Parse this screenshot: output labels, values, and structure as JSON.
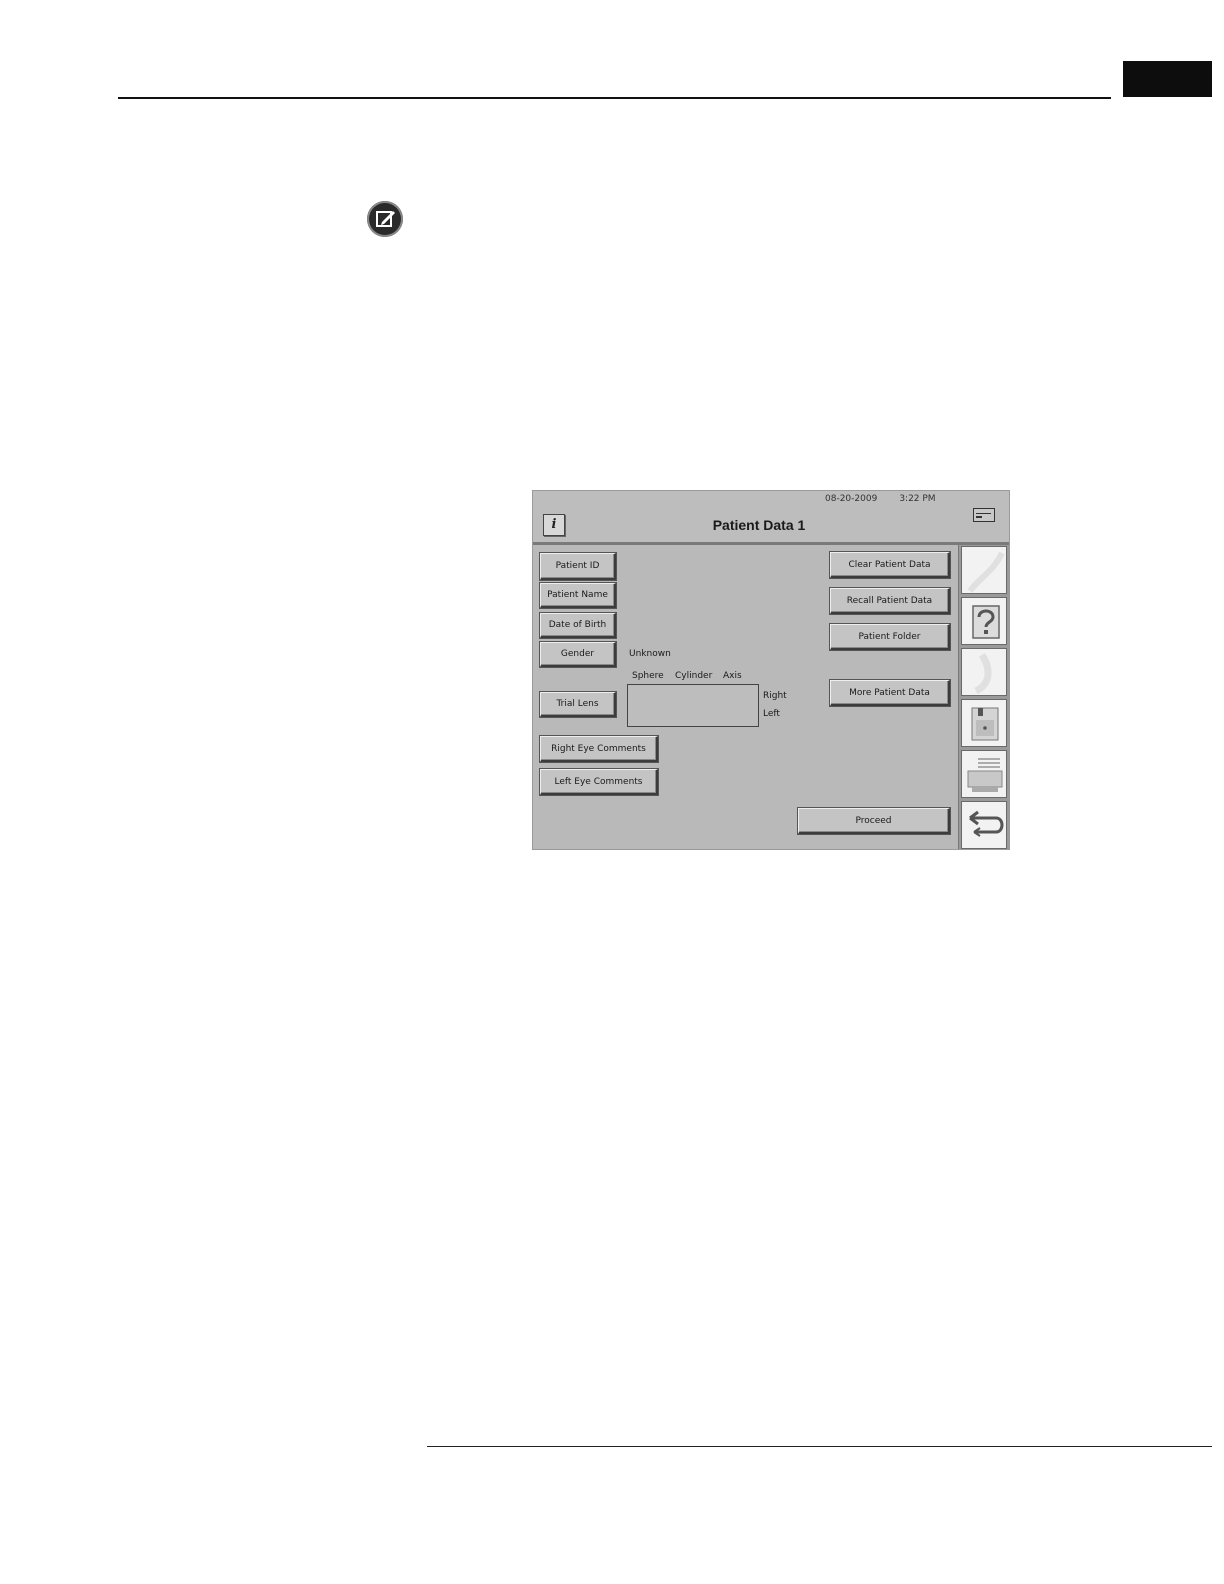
{
  "screen": {
    "date": "08-20-2009",
    "time": "3:22 PM",
    "title": "Patient Data 1",
    "info_label": "i"
  },
  "left_buttons": {
    "patient_id": "Patient ID",
    "patient_name": "Patient Name",
    "date_of_birth": "Date of Birth",
    "gender": "Gender",
    "trial_lens": "Trial Lens",
    "right_eye_comments": "Right Eye Comments",
    "left_eye_comments": "Left Eye Comments"
  },
  "gender_value": "Unknown",
  "trial_lens_table": {
    "columns": [
      "Sphere",
      "Cylinder",
      "Axis"
    ],
    "rows": [
      "Right",
      "Left"
    ]
  },
  "right_buttons": {
    "clear": "Clear Patient Data",
    "recall": "Recall Patient Data",
    "folder": "Patient Folder",
    "more": "More Patient Data",
    "proceed": "Proceed"
  },
  "toolbar_icons": [
    "blank-icon",
    "help-icon",
    "blank-icon",
    "floppy-disk-icon",
    "printer-icon",
    "return-arrow-icon"
  ]
}
